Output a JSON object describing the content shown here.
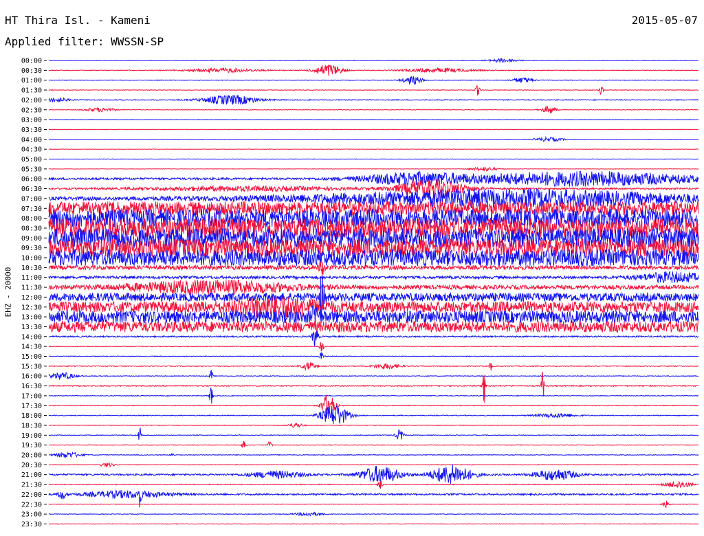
{
  "header": {
    "station": "HT Thira Isl. - Kameni",
    "date": "2015-05-07",
    "filter": "Applied filter: WWSSN-SP"
  },
  "axis": {
    "channel_label": "EHZ - 20000"
  },
  "colors": {
    "odd_row": "#1414f0",
    "even_row": "#f0143c",
    "background": "#ffffff"
  },
  "chart_data": {
    "type": "line",
    "title": "HT Thira Isl. - Kameni",
    "subtitle": "Applied filter: WWSSN-SP",
    "ylabel": "EHZ - 20000",
    "rows": [
      {
        "label": "00:00",
        "amp": 0.4,
        "events": [
          {
            "t": 0.7,
            "a": 3,
            "w": 0.02
          }
        ]
      },
      {
        "label": "00:30",
        "amp": 0.5,
        "events": [
          {
            "t": 0.43,
            "a": 9,
            "w": 0.02
          },
          {
            "t": 0.27,
            "a": 3,
            "w": 0.05
          },
          {
            "t": 0.6,
            "a": 3,
            "w": 0.05
          }
        ]
      },
      {
        "label": "01:00",
        "amp": 0.4,
        "events": [
          {
            "t": 0.56,
            "a": 6,
            "w": 0.015
          },
          {
            "t": 0.73,
            "a": 4,
            "w": 0.015
          }
        ]
      },
      {
        "label": "01:30",
        "amp": 0.4,
        "events": [
          {
            "t": 0.66,
            "a": 8,
            "w": 0.003
          },
          {
            "t": 0.85,
            "a": 6,
            "w": 0.003
          }
        ]
      },
      {
        "label": "02:00",
        "amp": 0.6,
        "events": [
          {
            "t": 0.28,
            "a": 7,
            "w": 0.04
          },
          {
            "t": 0.01,
            "a": 3,
            "w": 0.02
          }
        ]
      },
      {
        "label": "02:30",
        "amp": 0.4,
        "events": [
          {
            "t": 0.77,
            "a": 6,
            "w": 0.01
          },
          {
            "t": 0.08,
            "a": 3,
            "w": 0.02
          }
        ]
      },
      {
        "label": "03:00",
        "amp": 0.3,
        "events": []
      },
      {
        "label": "03:30",
        "amp": 0.3,
        "events": []
      },
      {
        "label": "04:00",
        "amp": 0.3,
        "events": [
          {
            "t": 0.77,
            "a": 3,
            "w": 0.02
          }
        ]
      },
      {
        "label": "04:30",
        "amp": 0.3,
        "events": []
      },
      {
        "label": "05:00",
        "amp": 0.3,
        "events": []
      },
      {
        "label": "05:30",
        "amp": 0.3,
        "events": [
          {
            "t": 0.67,
            "a": 3,
            "w": 0.02
          }
        ]
      },
      {
        "label": "06:00",
        "amp": 1.5,
        "events": [
          {
            "t": 0.82,
            "a": 10,
            "w": 0.18
          },
          {
            "t": 0.56,
            "a": 8,
            "w": 0.08
          }
        ]
      },
      {
        "label": "06:30",
        "amp": 1.2,
        "events": [
          {
            "t": 0.59,
            "a": 14,
            "w": 0.05
          },
          {
            "t": 0.3,
            "a": 3,
            "w": 0.15
          }
        ]
      },
      {
        "label": "07:00",
        "amp": 2.5,
        "events": [
          {
            "t": 0.7,
            "a": 12,
            "w": 0.3
          }
        ]
      },
      {
        "label": "07:30",
        "amp": 10,
        "events": []
      },
      {
        "label": "08:00",
        "amp": 13,
        "events": []
      },
      {
        "label": "08:30",
        "amp": 14,
        "events": []
      },
      {
        "label": "09:00",
        "amp": 14,
        "events": []
      },
      {
        "label": "09:30",
        "amp": 13,
        "events": []
      },
      {
        "label": "10:00",
        "amp": 12,
        "events": []
      },
      {
        "label": "10:30",
        "amp": 3,
        "events": [
          {
            "t": 0.42,
            "a": 10,
            "w": 0.005
          }
        ]
      },
      {
        "label": "11:00",
        "amp": 2,
        "events": [
          {
            "t": 0.96,
            "a": 7,
            "w": 0.05
          }
        ]
      },
      {
        "label": "11:30",
        "amp": 3,
        "events": [
          {
            "t": 0.25,
            "a": 9,
            "w": 0.12
          }
        ]
      },
      {
        "label": "12:00",
        "amp": 6,
        "events": [
          {
            "t": 0.42,
            "a": 30,
            "w": 0.004
          }
        ]
      },
      {
        "label": "12:30",
        "amp": 8,
        "events": [
          {
            "t": 0.35,
            "a": 10,
            "w": 0.06
          }
        ]
      },
      {
        "label": "13:00",
        "amp": 9,
        "events": [
          {
            "t": 0.41,
            "a": 18,
            "w": 0.004
          }
        ]
      },
      {
        "label": "13:30",
        "amp": 8,
        "events": []
      },
      {
        "label": "14:00",
        "amp": 1,
        "events": [
          {
            "t": 0.41,
            "a": 16,
            "w": 0.004
          }
        ]
      },
      {
        "label": "14:30",
        "amp": 0.5,
        "events": [
          {
            "t": 0.42,
            "a": 10,
            "w": 0.003
          }
        ]
      },
      {
        "label": "15:00",
        "amp": 0.5,
        "events": [
          {
            "t": 0.42,
            "a": 6,
            "w": 0.003
          }
        ]
      },
      {
        "label": "15:30",
        "amp": 0.6,
        "events": [
          {
            "t": 0.4,
            "a": 6,
            "w": 0.01
          },
          {
            "t": 0.52,
            "a": 4,
            "w": 0.02
          },
          {
            "t": 0.68,
            "a": 8,
            "w": 0.002
          }
        ]
      },
      {
        "label": "16:00",
        "amp": 0.5,
        "events": [
          {
            "t": 0.02,
            "a": 5,
            "w": 0.02
          },
          {
            "t": 0.25,
            "a": 10,
            "w": 0.002
          }
        ]
      },
      {
        "label": "16:30",
        "amp": 0.8,
        "events": [
          {
            "t": 0.67,
            "a": 30,
            "w": 0.002
          },
          {
            "t": 0.76,
            "a": 25,
            "w": 0.002
          }
        ]
      },
      {
        "label": "17:00",
        "amp": 0.5,
        "events": [
          {
            "t": 0.25,
            "a": 26,
            "w": 0.002
          }
        ]
      },
      {
        "label": "17:30",
        "amp": 0.5,
        "events": [
          {
            "t": 0.43,
            "a": 18,
            "w": 0.01
          }
        ]
      },
      {
        "label": "18:00",
        "amp": 0.6,
        "events": [
          {
            "t": 0.44,
            "a": 16,
            "w": 0.02
          },
          {
            "t": 0.78,
            "a": 3,
            "w": 0.03
          }
        ]
      },
      {
        "label": "18:30",
        "amp": 0.4,
        "events": [
          {
            "t": 0.38,
            "a": 4,
            "w": 0.01
          }
        ]
      },
      {
        "label": "19:00",
        "amp": 0.5,
        "events": [
          {
            "t": 0.54,
            "a": 8,
            "w": 0.006
          },
          {
            "t": 0.14,
            "a": 14,
            "w": 0.002
          }
        ]
      },
      {
        "label": "19:30",
        "amp": 0.4,
        "events": [
          {
            "t": 0.3,
            "a": 6,
            "w": 0.003
          },
          {
            "t": 0.34,
            "a": 5,
            "w": 0.003
          }
        ]
      },
      {
        "label": "20:00",
        "amp": 0.5,
        "events": [
          {
            "t": 0.03,
            "a": 4,
            "w": 0.02
          },
          {
            "t": 0.19,
            "a": 3,
            "w": 0.003
          }
        ]
      },
      {
        "label": "20:30",
        "amp": 0.4,
        "events": [
          {
            "t": 0.09,
            "a": 3,
            "w": 0.01
          }
        ]
      },
      {
        "label": "21:00",
        "amp": 1.2,
        "events": [
          {
            "t": 0.51,
            "a": 12,
            "w": 0.03
          },
          {
            "t": 0.62,
            "a": 14,
            "w": 0.03
          },
          {
            "t": 0.78,
            "a": 8,
            "w": 0.03
          },
          {
            "t": 0.35,
            "a": 5,
            "w": 0.04
          }
        ]
      },
      {
        "label": "21:30",
        "amp": 0.6,
        "events": [
          {
            "t": 0.97,
            "a": 5,
            "w": 0.02
          },
          {
            "t": 0.51,
            "a": 8,
            "w": 0.003
          }
        ]
      },
      {
        "label": "22:00",
        "amp": 1.2,
        "events": [
          {
            "t": 0.02,
            "a": 8,
            "w": 0.005
          },
          {
            "t": 0.12,
            "a": 5,
            "w": 0.06
          },
          {
            "t": 0.14,
            "a": 14,
            "w": 0.002
          }
        ]
      },
      {
        "label": "22:30",
        "amp": 0.4,
        "events": [
          {
            "t": 0.95,
            "a": 5,
            "w": 0.005
          }
        ]
      },
      {
        "label": "23:00",
        "amp": 0.4,
        "events": [
          {
            "t": 0.4,
            "a": 3,
            "w": 0.02
          }
        ]
      },
      {
        "label": "23:30",
        "amp": 0.4,
        "events": []
      }
    ]
  }
}
